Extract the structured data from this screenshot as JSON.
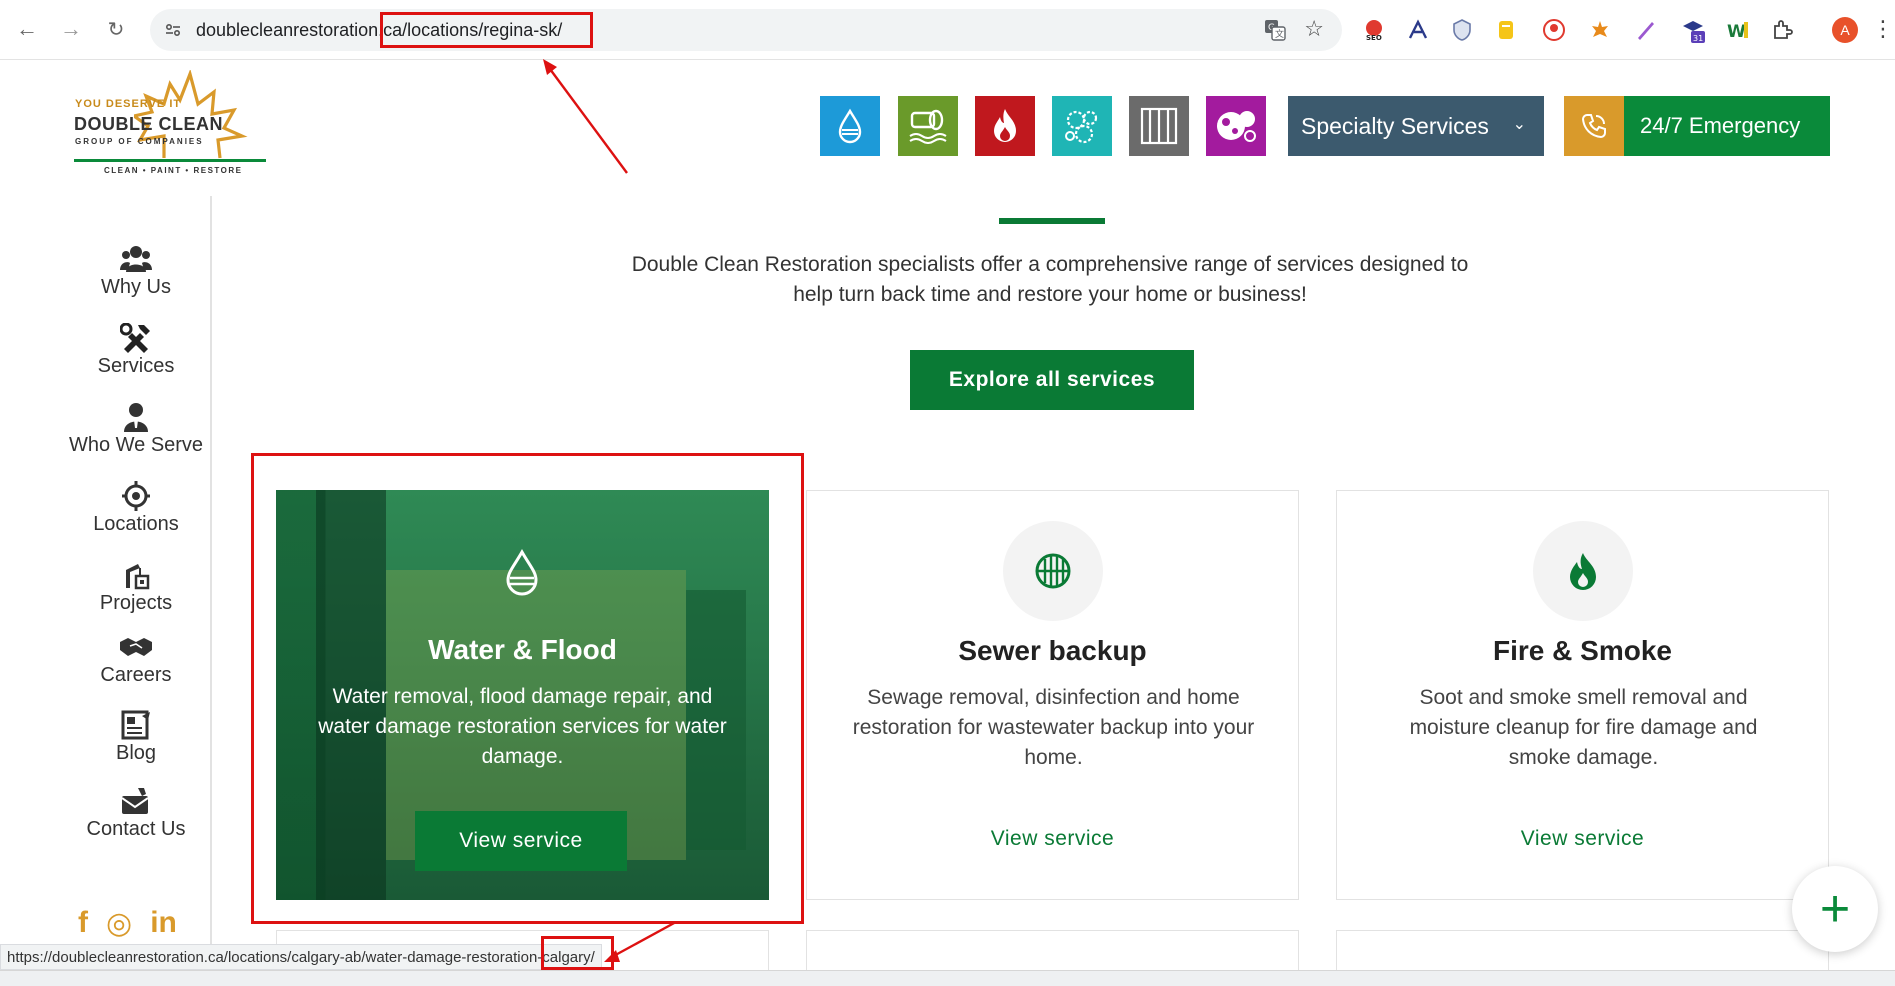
{
  "browser": {
    "url_prefix": "doublecleanrestoration.",
    "url_highlight": "ca/locations/regina-sk/",
    "avatar_letter": "A",
    "status_url": "https://doublecleanrestoration.ca/locations/calgary-ab/water-damage-restoration-calgary/"
  },
  "logo": {
    "tagline": "YOU DESERVE IT",
    "brand": "DOUBLE CLEAN",
    "sub": "GROUP OF COMPANIES",
    "motto": "CLEAN • PAINT • RESTORE"
  },
  "header": {
    "service_tiles": [
      {
        "icon": "water-drop-icon",
        "color": "#1d9ad8"
      },
      {
        "icon": "sewer-pipe-icon",
        "color": "#6a9a2a"
      },
      {
        "icon": "fire-icon",
        "color": "#c0181e"
      },
      {
        "icon": "mold-icon",
        "color": "#1fb5b5"
      },
      {
        "icon": "vent-icon",
        "color": "#6b6b6b"
      },
      {
        "icon": "bubbles-icon",
        "color": "#a31b9e"
      }
    ],
    "specialty_label": "Specialty Services",
    "emergency_label": "24/7 Emergency"
  },
  "sidebar": {
    "items": [
      {
        "label": "Why Us",
        "icon": "people-icon"
      },
      {
        "label": "Services",
        "icon": "tools-icon"
      },
      {
        "label": "Who We Serve",
        "icon": "person-icon"
      },
      {
        "label": "Locations",
        "icon": "target-icon"
      },
      {
        "label": "Projects",
        "icon": "crane-icon"
      },
      {
        "label": "Careers",
        "icon": "handshake-icon"
      },
      {
        "label": "Blog",
        "icon": "document-icon"
      },
      {
        "label": "Contact Us",
        "icon": "contact-icon"
      }
    ],
    "socials": [
      "f",
      "◎",
      "in"
    ]
  },
  "main": {
    "intro": "Double Clean Restoration specialists offer a comprehensive range of services designed to help turn back time and restore your home or business!",
    "explore_label": "Explore all services",
    "cards": [
      {
        "title": "Water & Flood",
        "desc": "Water removal, flood damage repair, and water damage restoration services for water damage.",
        "link": "View service"
      },
      {
        "title": "Sewer backup",
        "desc": "Sewage removal, disinfection and home restoration for wastewater backup into your home.",
        "link": "View service"
      },
      {
        "title": "Fire & Smoke",
        "desc": "Soot and smoke smell removal and moisture cleanup for fire damage and smoke damage.",
        "link": "View service"
      }
    ]
  },
  "colors": {
    "brand_green": "#0a7a35",
    "accent_gold": "#d99a2b",
    "specialty_blue": "#3c5a6e",
    "annotation_red": "#dd1111"
  }
}
